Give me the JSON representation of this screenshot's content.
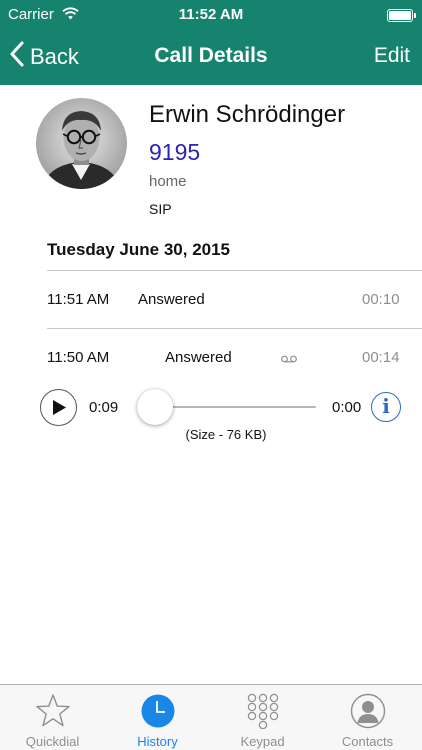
{
  "status_bar": {
    "carrier": "Carrier",
    "time": "11:52 AM",
    "icons": [
      "wifi-icon",
      "battery-icon"
    ]
  },
  "nav": {
    "back_label": "Back",
    "title": "Call Details",
    "edit_label": "Edit"
  },
  "contact": {
    "name": "Erwin Schrödinger",
    "number": "9195",
    "label": "home",
    "protocol": "SIP",
    "number_color": "#2a23b9"
  },
  "history": {
    "date": "Tuesday June 30, 2015",
    "calls": [
      {
        "time": "11:51 AM",
        "status": "Answered",
        "duration": "00:10"
      },
      {
        "time": "11:50 AM",
        "status": "Answered",
        "duration": "00:14",
        "icon": "voicemail-icon"
      }
    ]
  },
  "player": {
    "elapsed": "0:09",
    "remaining": "0:00",
    "progress": 0.0,
    "size_note": "(Size - 76 KB)",
    "icons": [
      "play-icon",
      "info-icon"
    ]
  },
  "tabs": [
    {
      "label": "Quickdial",
      "icon": "star-icon",
      "active": false
    },
    {
      "label": "History",
      "icon": "clock-icon",
      "active": true
    },
    {
      "label": "Keypad",
      "icon": "keypad-icon",
      "active": false
    },
    {
      "label": "Contacts",
      "icon": "contact-icon",
      "active": false
    }
  ],
  "colors": {
    "nav_bar": "#15836e",
    "active_tab": "#1a86e8",
    "info_blue": "#2c6bc4"
  }
}
